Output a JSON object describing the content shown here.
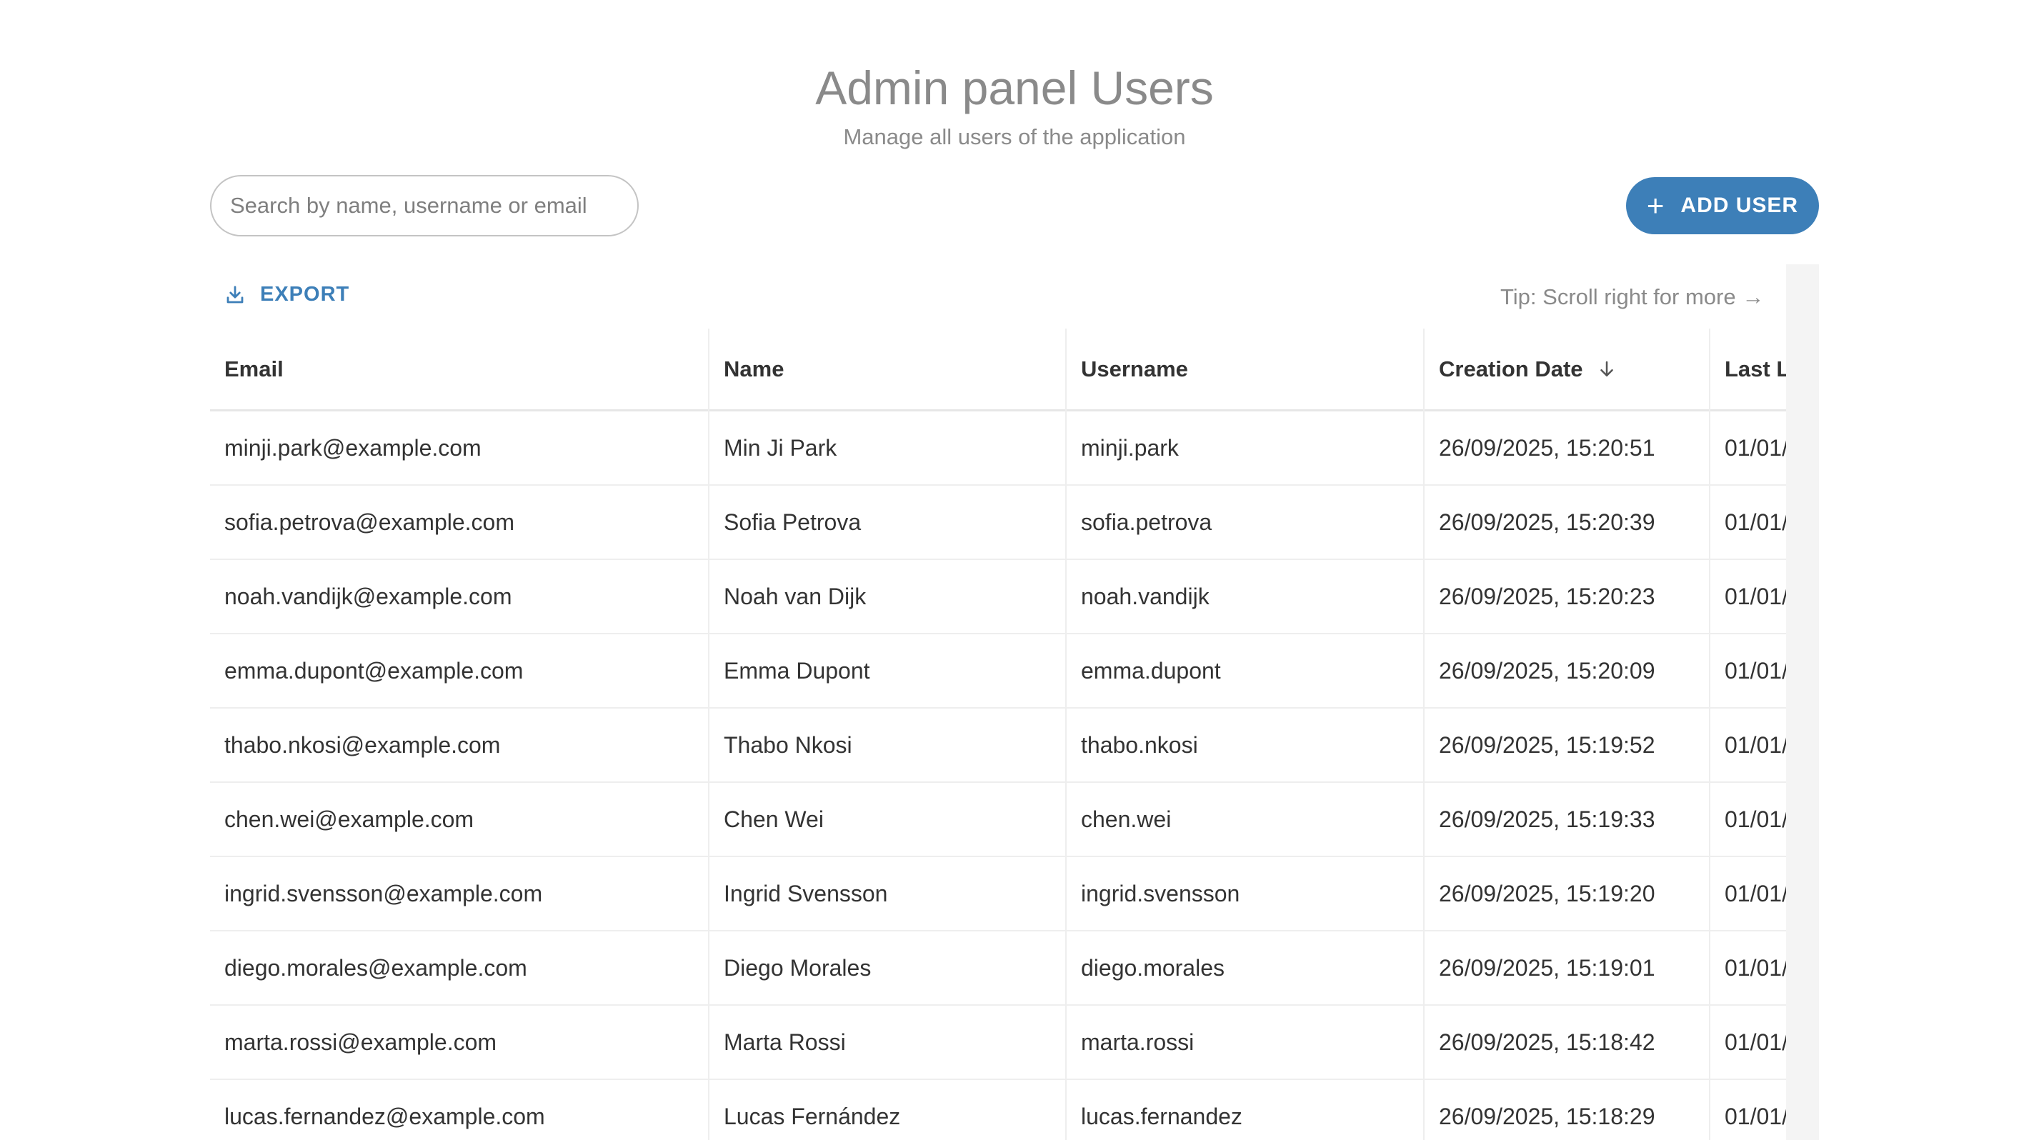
{
  "header": {
    "title": "Admin panel Users",
    "subtitle": "Manage all users of the application"
  },
  "toolbar": {
    "search_placeholder": "Search by name, username or email",
    "add_user_label": "ADD USER",
    "export_label": "EXPORT",
    "tip": "Tip: Scroll right for more →"
  },
  "icons": {
    "add": "plus-icon",
    "export": "download-icon",
    "sort": "arrow-down-icon"
  },
  "colors": {
    "accent": "#3d7fb8",
    "muted_text": "#8a8a8a",
    "text": "#333333"
  },
  "table": {
    "columns": [
      "Email",
      "Name",
      "Username",
      "Creation Date",
      "Last L"
    ],
    "rows": [
      [
        "minji.park@example.com",
        "Min Ji Park",
        "minji.park",
        "26/09/2025, 15:20:51",
        "01/01/"
      ],
      [
        "sofia.petrova@example.com",
        "Sofia Petrova",
        "sofia.petrova",
        "26/09/2025, 15:20:39",
        "01/01/"
      ],
      [
        "noah.vandijk@example.com",
        "Noah van Dijk",
        "noah.vandijk",
        "26/09/2025, 15:20:23",
        "01/01/"
      ],
      [
        "emma.dupont@example.com",
        "Emma Dupont",
        "emma.dupont",
        "26/09/2025, 15:20:09",
        "01/01/"
      ],
      [
        "thabo.nkosi@example.com",
        "Thabo Nkosi",
        "thabo.nkosi",
        "26/09/2025, 15:19:52",
        "01/01/"
      ],
      [
        "chen.wei@example.com",
        "Chen Wei",
        "chen.wei",
        "26/09/2025, 15:19:33",
        "01/01/"
      ],
      [
        "ingrid.svensson@example.com",
        "Ingrid Svensson",
        "ingrid.svensson",
        "26/09/2025, 15:19:20",
        "01/01/"
      ],
      [
        "diego.morales@example.com",
        "Diego Morales",
        "diego.morales",
        "26/09/2025, 15:19:01",
        "01/01/"
      ],
      [
        "marta.rossi@example.com",
        "Marta Rossi",
        "marta.rossi",
        "26/09/2025, 15:18:42",
        "01/01/"
      ],
      [
        "lucas.fernandez@example.com",
        "Lucas Fernández",
        "lucas.fernandez",
        "26/09/2025, 15:18:29",
        "01/01/"
      ]
    ]
  }
}
